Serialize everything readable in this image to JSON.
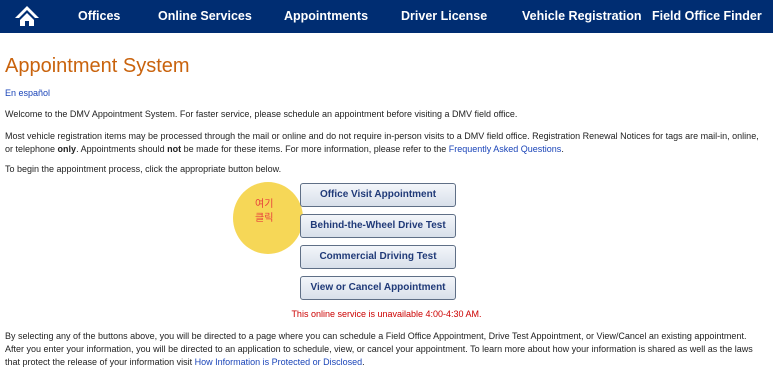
{
  "nav": {
    "home_icon": "home-icon",
    "items": [
      "Offices",
      "Online Services",
      "Appointments",
      "Driver License",
      "Vehicle Registration",
      "Field Office Finder"
    ]
  },
  "page": {
    "title": "Appointment System",
    "spanish_link": "En español",
    "intro": "Welcome to the DMV Appointment System. For faster service, please schedule an appointment before visiting a DMV field office.",
    "vehicle_p": {
      "part1": "Most vehicle registration items may be processed through the mail or online and do not require in-person visits to a DMV field office. Registration Renewal Notices for tags are mail-in, online, or telephone ",
      "bold1": "only",
      "part2": ". Appointments should ",
      "bold2": "not",
      "part3": " be made for these items. For more information, please refer to the ",
      "faq_link": "Frequently Asked Questions",
      "part4": "."
    },
    "begin_text": "To begin the appointment process, click the appropriate button below."
  },
  "annotation": {
    "line1": "여기",
    "line2": "클릭",
    "color": "#f6d757"
  },
  "buttons": [
    "Office Visit Appointment",
    "Behind-the-Wheel Drive Test",
    "Commercial Driving Test",
    "View or Cancel Appointment"
  ],
  "notice": "This online service is unavailable 4:00-4:30 AM.",
  "footer_p": {
    "text": "By selecting any of the buttons above, you will be directed to a page where you can schedule a Field Office Appointment, Drive Test Appointment, or View/Cancel an existing appointment. After you enter your information, you will be directed to an application to schedule, view, or cancel your appointment. To learn more about how your information is shared as well as the laws that protect the release of your information visit ",
    "link": "How Information is Protected or Disclosed",
    "end": "."
  },
  "colors": {
    "nav_bg": "#002d72",
    "title": "#c9630d",
    "link": "#1a44b8",
    "notice": "#cc0000"
  }
}
